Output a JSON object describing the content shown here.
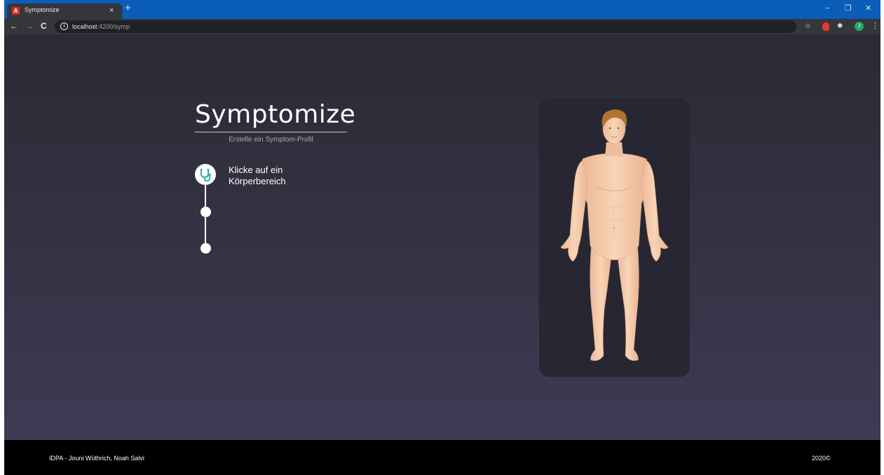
{
  "browser": {
    "tab": {
      "title": "Symptomize",
      "favicon": "A",
      "close": "×"
    },
    "new_tab": "+",
    "window_controls": {
      "minimize": "−",
      "restore": "❐",
      "close": "✕"
    },
    "nav": {
      "back": "←",
      "forward": "→",
      "reload": "C"
    },
    "address": {
      "host": "localhost",
      "rest": ":4200/symp"
    },
    "toolbar_icons": {
      "bookmark": "☆",
      "extensions": "✱",
      "menu": "⋮"
    },
    "profile_initial": "J"
  },
  "page": {
    "title": "Symptomize",
    "subtitle": "Erstelle ein Symptom-Profil",
    "steps": [
      {
        "label": "Klicke auf ein Körperbereich",
        "icon": "stethoscope-icon",
        "active": true
      },
      {
        "label": "",
        "active": false
      },
      {
        "label": "",
        "active": false
      }
    ]
  },
  "footer": {
    "left": "IDPA - Jouni Wüthrich, Noah Salvi",
    "right": "2020©"
  },
  "colors": {
    "tabbar": "#0a5db8",
    "toolbar": "#35363a",
    "page_bg_top": "#2a2b35",
    "page_bg_bottom": "#3f3a55",
    "panel": "#272733",
    "accent_teal": "#3aa8b4",
    "skin": "#f4ccaa",
    "hair": "#b07435"
  }
}
